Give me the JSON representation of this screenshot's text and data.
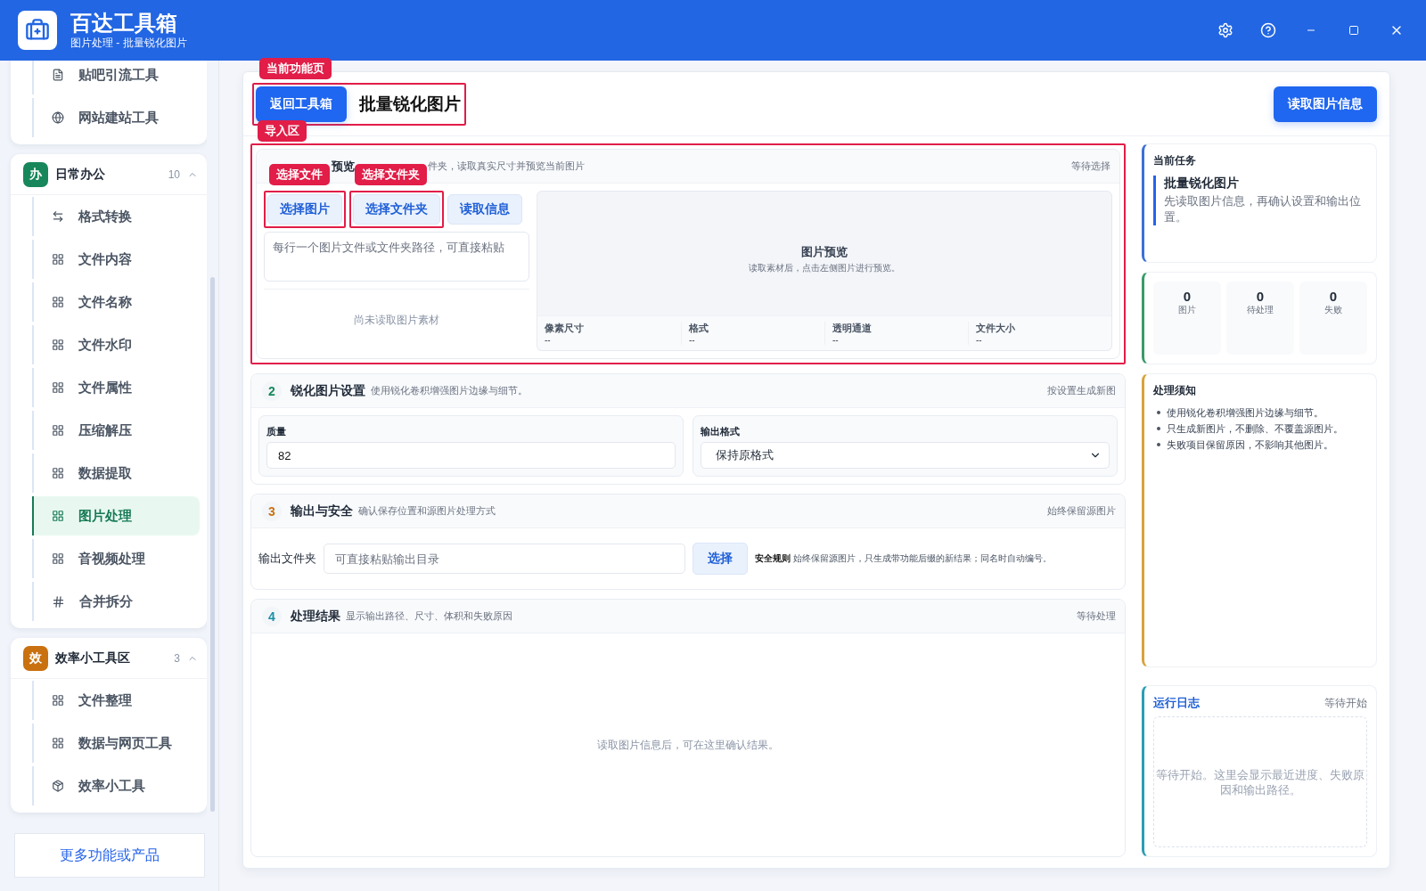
{
  "window": {
    "title": "百达工具箱",
    "subtitle": "图片处理 - 批量锐化图片"
  },
  "sidebar": {
    "groups": [
      {
        "kind": "plain",
        "items": [
          {
            "label": "贴吧引流工具",
            "kind": "doc",
            "selected": false
          },
          {
            "label": "网站建站工具",
            "kind": "globe",
            "selected": false
          }
        ]
      },
      {
        "kind": "titled",
        "badge": "办",
        "title": "日常办公",
        "count": "10",
        "color": "#17875b",
        "expanded": true,
        "items": [
          {
            "label": "格式转换",
            "kind": "swap",
            "selected": false
          },
          {
            "label": "文件内容",
            "kind": "grid",
            "selected": false
          },
          {
            "label": "文件名称",
            "kind": "grid",
            "selected": false
          },
          {
            "label": "文件水印",
            "kind": "grid",
            "selected": false
          },
          {
            "label": "文件属性",
            "kind": "grid",
            "selected": false
          },
          {
            "label": "压缩解压",
            "kind": "grid",
            "selected": false
          },
          {
            "label": "数据提取",
            "kind": "grid",
            "selected": false
          },
          {
            "label": "图片处理",
            "kind": "grid",
            "selected": true
          },
          {
            "label": "音视频处理",
            "kind": "grid",
            "selected": false
          },
          {
            "label": "合并拆分",
            "kind": "hash",
            "selected": false
          }
        ]
      },
      {
        "kind": "titled",
        "badge": "效",
        "title": "效率小工具区",
        "count": "3",
        "color": "#c9700f",
        "expanded": true,
        "items": [
          {
            "label": "文件整理",
            "kind": "grid",
            "selected": false
          },
          {
            "label": "数据与网页工具",
            "kind": "grid",
            "selected": false
          },
          {
            "label": "效率小工具",
            "kind": "box",
            "selected": false
          }
        ]
      }
    ],
    "more_button": "更多功能或产品"
  },
  "page_header": {
    "annotation": "当前功能页",
    "back_button": "返回工具箱",
    "title": "批量锐化图片",
    "action_button": "读取图片信息"
  },
  "import_section": {
    "annotation": "导入区",
    "title": "预览",
    "description": "件夹，读取真实尺寸并预览当前图片",
    "status": "等待选择",
    "buttons": [
      {
        "label": "选择图片",
        "annotation": "选择文件"
      },
      {
        "label": "选择文件夹",
        "annotation": "选择文件夹"
      },
      {
        "label": "读取信息"
      }
    ],
    "paths": {
      "placeholder": "每行一个图片文件或文件夹路径，可直接粘贴"
    },
    "empty": "尚未读取图片素材",
    "preview": {
      "title": "图片预览",
      "description": "读取素材后，点击左侧图片进行预览。",
      "meta": [
        {
          "label": "像素尺寸",
          "value": "--"
        },
        {
          "label": "格式",
          "value": "--"
        },
        {
          "label": "透明通道",
          "value": "--"
        },
        {
          "label": "文件大小",
          "value": "--"
        }
      ]
    }
  },
  "settings_section": {
    "number": "2",
    "color": "#17875b",
    "title": "锐化图片设置",
    "description": "使用锐化卷积增强图片边缘与细节。",
    "status": "按设置生成新图",
    "quality": {
      "label": "质量",
      "value": "82"
    },
    "format": {
      "label": "输出格式",
      "value": "保持原格式"
    }
  },
  "output_section": {
    "number": "3",
    "color": "#c9700f",
    "title": "输出与安全",
    "description": "确认保存位置和源图片处理方式",
    "status": "始终保留源图片",
    "folder_label": "输出文件夹",
    "folder": {
      "placeholder": "可直接粘贴输出目录"
    },
    "choose_button": "选择",
    "rule": "**安全规则** 始终保留源图片，只生成带功能后缀的新结果；同名时自动编号。"
  },
  "result_section": {
    "number": "4",
    "color": "#1b8fa6",
    "title": "处理结果",
    "description": "显示输出路径、尺寸、体积和失败原因",
    "status": "等待处理",
    "empty": "读取图片信息后，可在这里确认结果。"
  },
  "task_card": {
    "label": "当前任务",
    "title": "批量锐化图片",
    "description": "先读取图片信息，再确认设置和输出位置。"
  },
  "stats": [
    {
      "value": "0",
      "label": "图片"
    },
    {
      "value": "0",
      "label": "待处理"
    },
    {
      "value": "0",
      "label": "失败"
    }
  ],
  "notice": {
    "title": "处理须知",
    "items": [
      "使用锐化卷积增强图片边缘与细节。",
      "只生成新图片，不删除、不覆盖源图片。",
      "失败项目保留原因，不影响其他图片。"
    ]
  },
  "log": {
    "title": "运行日志",
    "status": "等待开始",
    "empty": "等待开始。这里会显示最近进度、失败原因和输出路径。"
  }
}
